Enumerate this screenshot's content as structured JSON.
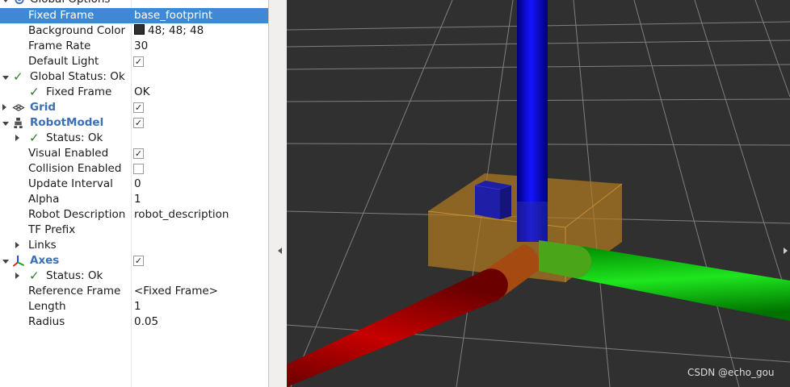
{
  "tree": {
    "global_options": {
      "label": "Global Options"
    },
    "fixed_frame": {
      "label": "Fixed Frame",
      "value": "base_footprint"
    },
    "background_color": {
      "label": "Background Color",
      "value": "48; 48; 48",
      "color": "#303030"
    },
    "frame_rate": {
      "label": "Frame Rate",
      "value": "30"
    },
    "default_light": {
      "label": "Default Light",
      "checked": true
    },
    "global_status": {
      "label": "Global Status: Ok"
    },
    "gs_fixed_frame": {
      "label": "Fixed Frame",
      "value": "OK"
    },
    "grid": {
      "label": "Grid",
      "checked": true
    },
    "robot_model": {
      "label": "RobotModel",
      "checked": true
    },
    "rm_status": {
      "label": "Status: Ok"
    },
    "visual_enabled": {
      "label": "Visual Enabled",
      "checked": true
    },
    "collision_enabled": {
      "label": "Collision Enabled",
      "checked": false
    },
    "update_interval": {
      "label": "Update Interval",
      "value": "0"
    },
    "alpha": {
      "label": "Alpha",
      "value": "1"
    },
    "robot_description": {
      "label": "Robot Description",
      "value": "robot_description"
    },
    "tf_prefix": {
      "label": "TF Prefix",
      "value": ""
    },
    "links": {
      "label": "Links"
    },
    "axes": {
      "label": "Axes",
      "checked": true
    },
    "axes_status": {
      "label": "Status: Ok"
    },
    "reference_frame": {
      "label": "Reference Frame",
      "value": "<Fixed Frame>"
    },
    "length": {
      "label": "Length",
      "value": "1"
    },
    "radius": {
      "label": "Radius",
      "value": "0.05"
    }
  },
  "viewport": {
    "watermark": "CSDN @echo_gou",
    "background": "#303030",
    "colors": {
      "x_axis": "#d40000",
      "y_axis": "#00d400",
      "z_axis": "#0000e0",
      "base": "#b47a1e"
    }
  },
  "icons": [
    "global-options-icon",
    "grid-icon",
    "robot-model-icon",
    "axes-icon",
    "status-ok-check-icon"
  ]
}
